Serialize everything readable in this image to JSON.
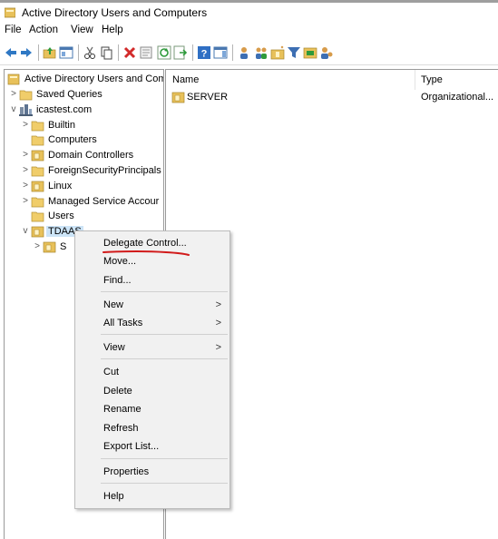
{
  "window": {
    "title": "Active Directory Users and Computers"
  },
  "menu": [
    "File",
    "Action",
    "View",
    "Help"
  ],
  "toolbar_icons": [
    "back-icon",
    "forward-icon",
    "up-folder-icon",
    "show-console-tree-icon",
    "cut-icon",
    "copy-icon",
    "delete-icon",
    "properties-icon",
    "refresh-icon",
    "export-list-icon",
    "help-icon",
    "show-action-pane-icon",
    "new-user-icon",
    "new-group-icon",
    "new-ou-icon",
    "filter-icon",
    "add-to-group-icon",
    "delegate-icon"
  ],
  "tree": {
    "root": "Active Directory Users and Com",
    "items": [
      {
        "label": "Saved Queries",
        "indent": 1,
        "expander": ">"
      },
      {
        "label": "icastest.com",
        "indent": 1,
        "expander": "v"
      },
      {
        "label": "Builtin",
        "indent": 2,
        "expander": ">"
      },
      {
        "label": "Computers",
        "indent": 2,
        "expander": ""
      },
      {
        "label": "Domain Controllers",
        "indent": 2,
        "expander": ">"
      },
      {
        "label": "ForeignSecurityPrincipals",
        "indent": 2,
        "expander": ">"
      },
      {
        "label": "Linux",
        "indent": 2,
        "expander": ">"
      },
      {
        "label": "Managed Service Accour",
        "indent": 2,
        "expander": ">"
      },
      {
        "label": "Users",
        "indent": 2,
        "expander": ""
      },
      {
        "label": "TDAAS",
        "indent": 2,
        "expander": "v"
      },
      {
        "label": "S",
        "indent": 3,
        "expander": ">"
      }
    ]
  },
  "list": {
    "columns": [
      "Name",
      "Type"
    ],
    "rows": [
      {
        "name": "SERVER",
        "type": "Organizational..."
      }
    ]
  },
  "context_menu": {
    "items": [
      "Delegate Control...",
      "Move...",
      "Find...",
      "New",
      "All Tasks",
      "View",
      "Cut",
      "Delete",
      "Rename",
      "Refresh",
      "Export List...",
      "Properties",
      "Help"
    ],
    "submenu_arrow": ">"
  },
  "colors": {
    "annotation": "#d11a1a",
    "selection": "#cce4f7",
    "folder": "#e8c15a"
  }
}
